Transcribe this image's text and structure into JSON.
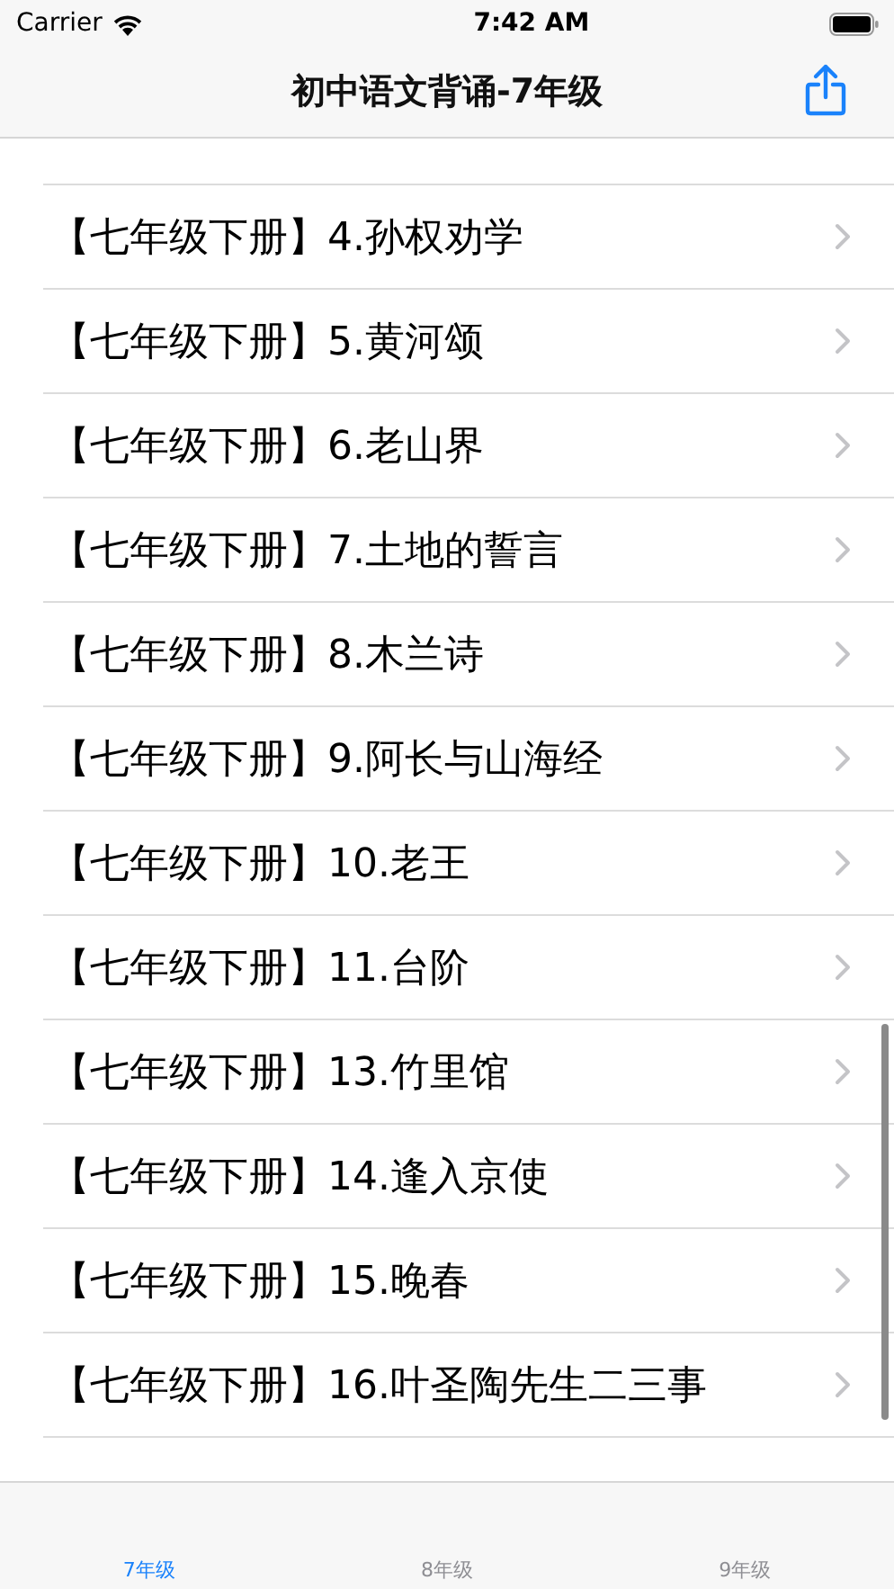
{
  "status_bar": {
    "carrier": "Carrier",
    "time": "7:42 AM"
  },
  "nav_bar": {
    "title": "初中语文背诵-7年级"
  },
  "list": {
    "items": [
      {
        "label": "【七年级下册】4.孙权劝学"
      },
      {
        "label": "【七年级下册】5.黄河颂"
      },
      {
        "label": "【七年级下册】6.老山界"
      },
      {
        "label": "【七年级下册】7.土地的誓言"
      },
      {
        "label": "【七年级下册】8.木兰诗"
      },
      {
        "label": "【七年级下册】9.阿长与山海经"
      },
      {
        "label": "【七年级下册】10.老王"
      },
      {
        "label": "【七年级下册】11.台阶"
      },
      {
        "label": "【七年级下册】13.竹里馆"
      },
      {
        "label": "【七年级下册】14.逢入京使"
      },
      {
        "label": "【七年级下册】15.晚春"
      },
      {
        "label": "【七年级下册】16.叶圣陶先生二三事"
      }
    ]
  },
  "tab_bar": {
    "tabs": [
      {
        "label": "7年级",
        "selected": true
      },
      {
        "label": "8年级",
        "selected": false
      },
      {
        "label": "9年级",
        "selected": false
      }
    ]
  }
}
